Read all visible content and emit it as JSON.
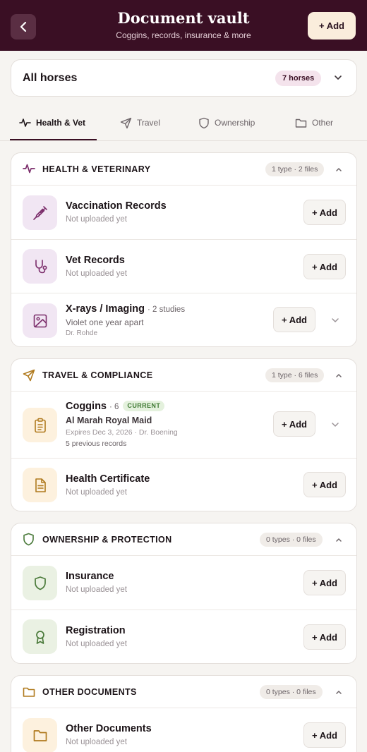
{
  "header": {
    "title": "Document vault",
    "subtitle": "Coggins, records, insurance & more",
    "add_label": "+ Add",
    "back_icon": "chevron-left-icon"
  },
  "selector": {
    "label": "All horses",
    "badge": "7 horses"
  },
  "tabs": [
    {
      "label": "Health & Vet",
      "icon": "pulse-icon",
      "active": true
    },
    {
      "label": "Travel",
      "icon": "send-icon",
      "active": false
    },
    {
      "label": "Ownership",
      "icon": "shield-icon",
      "active": false
    },
    {
      "label": "Other",
      "icon": "folder-icon",
      "active": false
    }
  ],
  "add_label": "+ Add",
  "sections": [
    {
      "title": "HEALTH & VETERINARY",
      "count": "1 type · 2 files",
      "icon": "pulse-icon",
      "items": [
        {
          "title": "Vaccination Records",
          "status": "Not uploaded yet",
          "icon": "syringe-icon"
        },
        {
          "title": "Vet Records",
          "status": "Not uploaded yet",
          "icon": "stethoscope-icon"
        },
        {
          "title": "X-rays / Imaging",
          "meta": "· 2 studies",
          "line2": "Violet one year apart",
          "line3": "Dr. Rohde",
          "icon": "image-icon"
        }
      ]
    },
    {
      "title": "TRAVEL & COMPLIANCE",
      "count": "1 type · 6 files",
      "icon": "send-icon",
      "items": [
        {
          "title": "Coggins",
          "meta": "· 6",
          "badge": "CURRENT",
          "line2": "Al Marah Royal Maid",
          "line3": "Expires Dec 3, 2026 · Dr. Boening",
          "line4": "5 previous records",
          "icon": "clipboard-icon"
        },
        {
          "title": "Health Certificate",
          "status": "Not uploaded yet",
          "icon": "document-icon"
        }
      ]
    },
    {
      "title": "OWNERSHIP & PROTECTION",
      "count": "0 types · 0 files",
      "icon": "shield-icon",
      "items": [
        {
          "title": "Insurance",
          "status": "Not uploaded yet",
          "icon": "shield-icon"
        },
        {
          "title": "Registration",
          "status": "Not uploaded yet",
          "icon": "award-icon"
        }
      ]
    },
    {
      "title": "OTHER DOCUMENTS",
      "count": "0 types · 0 files",
      "icon": "folder-icon",
      "items": [
        {
          "title": "Other Documents",
          "status": "Not uploaded yet",
          "icon": "folder-icon"
        }
      ]
    }
  ],
  "colors": {
    "header_bg": "#3a0f24",
    "accent": "#3a0f24",
    "health": "#7b2d6b",
    "travel": "#b07a1e",
    "ownership": "#4a7a3a",
    "other": "#b07a1e",
    "current_badge": "#3f7a33"
  }
}
